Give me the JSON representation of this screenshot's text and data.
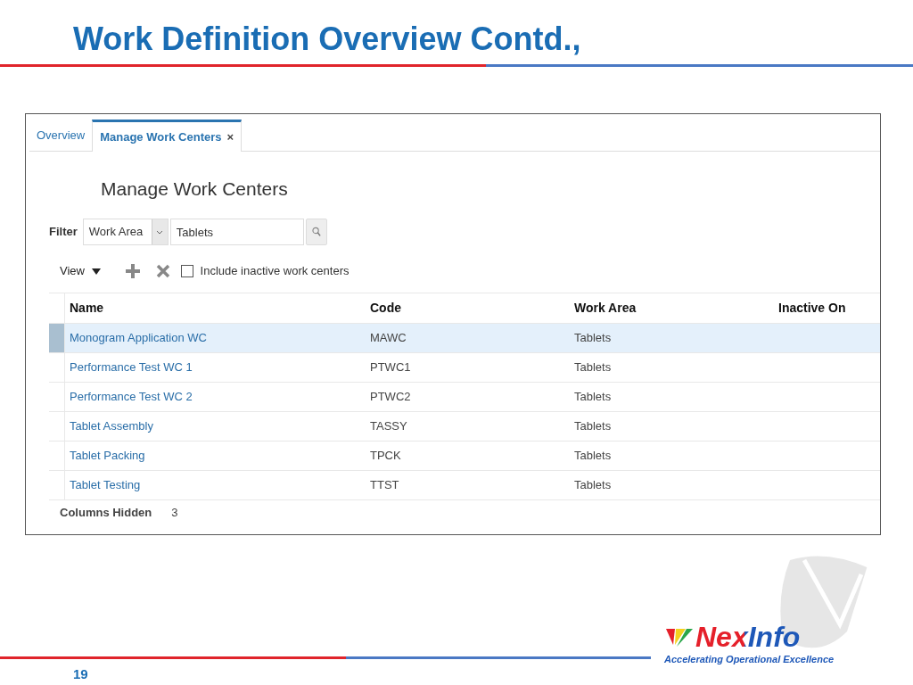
{
  "slide_title": "Work Definition Overview Contd.,",
  "tabs": [
    {
      "label": "Overview",
      "selected": false
    },
    {
      "label": "Manage Work Centers",
      "selected": true,
      "close": "×"
    }
  ],
  "page_heading": "Manage Work Centers",
  "filter": {
    "label": "Filter",
    "field": "Work Area",
    "value": "Tablets"
  },
  "toolbar": {
    "view": "View",
    "include_inactive": {
      "label": "Include inactive work centers",
      "checked": false
    }
  },
  "table": {
    "columns": [
      "Name",
      "Code",
      "Work Area",
      "Inactive On"
    ],
    "rows": [
      {
        "cells": [
          "Monogram Application WC",
          "MAWC",
          "Tablets"
        ],
        "selected": true
      },
      {
        "cells": [
          "Performance Test WC 1",
          "PTWC1",
          "Tablets"
        ],
        "selected": false
      },
      {
        "cells": [
          "Performance Test WC 2",
          "PTWC2",
          "Tablets"
        ],
        "selected": false
      },
      {
        "cells": [
          "Tablet Assembly",
          "TASSY",
          "Tablets"
        ],
        "selected": false
      },
      {
        "cells": [
          "Tablet Packing",
          "TPCK",
          "Tablets"
        ],
        "selected": false
      },
      {
        "cells": [
          "Tablet Testing",
          "TTST",
          "Tablets"
        ],
        "selected": false
      }
    ]
  },
  "columns_hidden": {
    "label": "Columns Hidden",
    "value": "3"
  },
  "logo": {
    "name": "NexInfo",
    "tagline": "Accelerating Operational Excellence"
  },
  "page_number": "19"
}
